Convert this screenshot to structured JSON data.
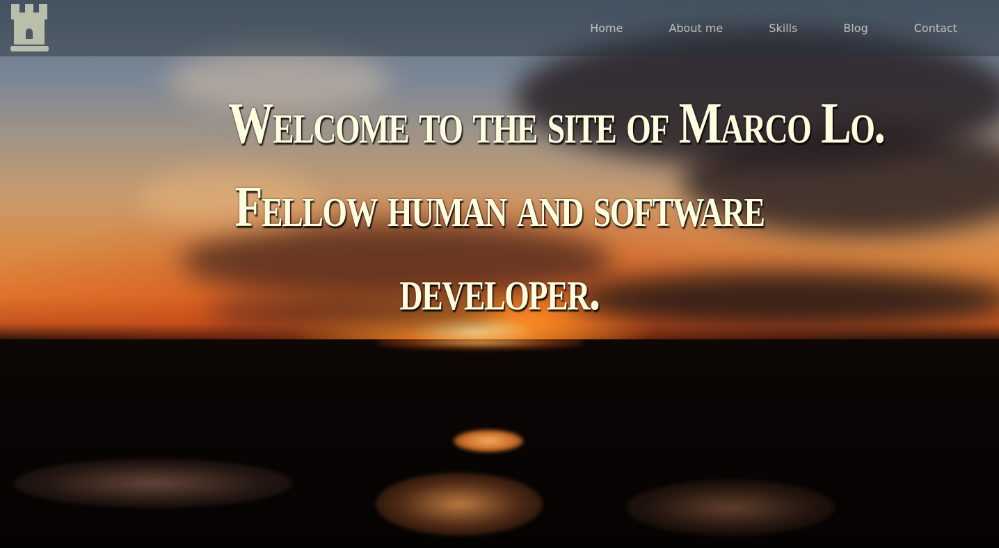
{
  "header": {
    "logo_icon": "castle-tower-icon",
    "nav": [
      "Home",
      "About me",
      "Skills",
      "Blog",
      "Contact"
    ]
  },
  "hero": {
    "headline_lines": [
      "Welcome to the site of Marco Lo.",
      "Fellow human and software",
      "developer."
    ],
    "text_color": "#fffde0",
    "background_description": "sunset"
  }
}
